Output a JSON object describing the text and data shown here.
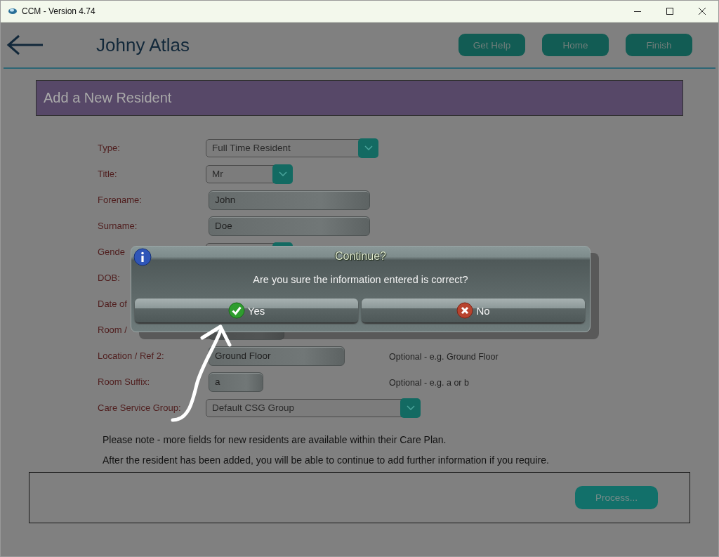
{
  "window": {
    "title": "CCM - Version 4.74"
  },
  "header": {
    "name": "Johny Atlas",
    "buttons": [
      "Get Help",
      "Home",
      "Finish"
    ]
  },
  "section_title": "Add a New Resident",
  "form": {
    "fields": [
      {
        "label": "Type:",
        "kind": "select",
        "value": "Full Time Resident"
      },
      {
        "label": "Title:",
        "kind": "select",
        "value": "Mr"
      },
      {
        "label": "Forename:",
        "kind": "input",
        "value": "John"
      },
      {
        "label": "Surname:",
        "kind": "input",
        "value": "Doe"
      },
      {
        "label": "Gende",
        "kind": "select"
      },
      {
        "label": "DOB:",
        "kind": "plain"
      },
      {
        "label": "Date of",
        "kind": "plain"
      },
      {
        "label": "Room /",
        "kind": "input"
      },
      {
        "label": "Location / Ref 2:",
        "kind": "input",
        "value": "Ground Floor",
        "hint": "Optional - e.g. Ground Floor"
      },
      {
        "label": "Room Suffix:",
        "kind": "input",
        "value": "a",
        "hint": "Optional - e.g. a or b"
      },
      {
        "label": "Care Service Group:",
        "kind": "select",
        "value": "Default CSG Group"
      }
    ]
  },
  "notes": [
    "Please note - more fields for new residents are available within their Care Plan.",
    "After the resident has been added, you will be able to continue to add further information if you require."
  ],
  "footer": {
    "button": "Process..."
  },
  "dialog": {
    "title": "Continue?",
    "message": "Are you sure the information entered is correct?",
    "buttons": [
      {
        "label": "Yes",
        "kind": "yes"
      },
      {
        "label": "No",
        "kind": "no"
      }
    ]
  }
}
